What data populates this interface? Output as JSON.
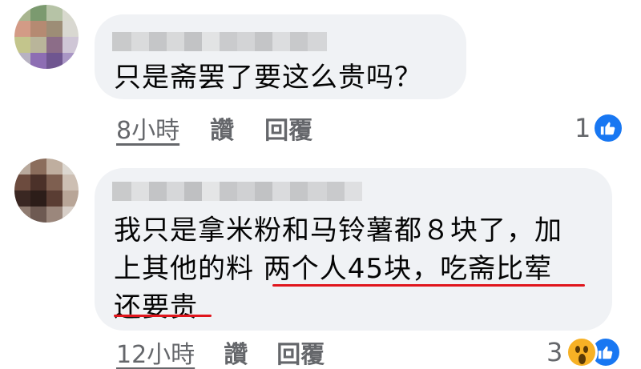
{
  "comments": [
    {
      "text_lines": [
        "只是斋罢了要这么贵吗？"
      ],
      "time": "8小時",
      "like_action": "讚",
      "reply_action": "回覆",
      "reaction_count": "1",
      "reactions": [
        "like-icon"
      ]
    },
    {
      "text_lines": [
        "我只是拿米粉和马铃薯都８块了，加",
        "上其他的料 两个人45块，吃斋比荤",
        "还要贵"
      ],
      "time": "12小時",
      "like_action": "讚",
      "reply_action": "回覆",
      "reaction_count": "3",
      "reactions": [
        "wow-icon",
        "like-icon"
      ]
    }
  ],
  "colors": {
    "bubble": "#f0f2f5",
    "meta_text": "#65676b",
    "like_blue": "#1877f2",
    "annotation_red": "#e0151c"
  }
}
